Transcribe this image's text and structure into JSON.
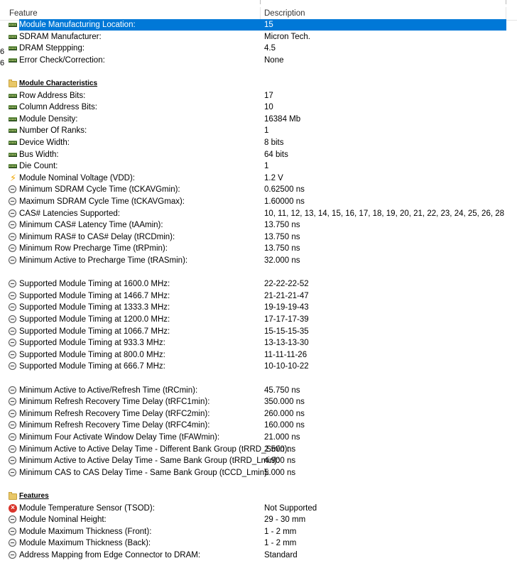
{
  "columns": {
    "feature": "Feature",
    "description": "Description"
  },
  "left_fragments": [
    "6",
    "6"
  ],
  "rows": [
    {
      "type": "item",
      "icon": "memory-module-icon",
      "feature": "Module Manufacturing Location:",
      "value": "15",
      "selected": true
    },
    {
      "type": "item",
      "icon": "memory-module-icon",
      "feature": "SDRAM Manufacturer:",
      "value": "Micron Tech."
    },
    {
      "type": "item",
      "icon": "memory-module-icon",
      "feature": "DRAM Steppping:",
      "value": "4.5"
    },
    {
      "type": "item",
      "icon": "memory-module-icon",
      "feature": "Error Check/Correction:",
      "value": "None"
    },
    {
      "type": "blank"
    },
    {
      "type": "section",
      "icon": "folder-icon",
      "feature": "Module Characteristics"
    },
    {
      "type": "item",
      "icon": "memory-module-icon",
      "feature": "Row Address Bits:",
      "value": "17"
    },
    {
      "type": "item",
      "icon": "memory-module-icon",
      "feature": "Column Address Bits:",
      "value": "10"
    },
    {
      "type": "item",
      "icon": "memory-module-icon",
      "feature": "Module Density:",
      "value": "16384 Mb"
    },
    {
      "type": "item",
      "icon": "memory-module-icon",
      "feature": "Number Of Ranks:",
      "value": "1"
    },
    {
      "type": "item",
      "icon": "memory-module-icon",
      "feature": "Device Width:",
      "value": "8 bits"
    },
    {
      "type": "item",
      "icon": "memory-module-icon",
      "feature": "Bus Width:",
      "value": "64 bits"
    },
    {
      "type": "item",
      "icon": "memory-module-icon",
      "feature": "Die Count:",
      "value": "1"
    },
    {
      "type": "item",
      "icon": "voltage-icon",
      "feature": "Module Nominal Voltage (VDD):",
      "value": "1.2 V"
    },
    {
      "type": "item",
      "icon": "clock-icon",
      "feature": "Minimum SDRAM Cycle Time (tCKAVGmin):",
      "value": "0.62500 ns"
    },
    {
      "type": "item",
      "icon": "clock-icon",
      "feature": "Maximum SDRAM Cycle Time (tCKAVGmax):",
      "value": "1.60000 ns"
    },
    {
      "type": "item",
      "icon": "clock-icon",
      "feature": "CAS# Latencies Supported:",
      "value": "10, 11, 12, 13, 14, 15, 16, 17, 18, 19, 20, 21, 22, 23, 24, 25, 26, 28"
    },
    {
      "type": "item",
      "icon": "clock-icon",
      "feature": "Minimum CAS# Latency Time (tAAmin):",
      "value": "13.750 ns"
    },
    {
      "type": "item",
      "icon": "clock-icon",
      "feature": "Minimum RAS# to CAS# Delay (tRCDmin):",
      "value": "13.750 ns"
    },
    {
      "type": "item",
      "icon": "clock-icon",
      "feature": "Minimum Row Precharge Time (tRPmin):",
      "value": "13.750 ns"
    },
    {
      "type": "item",
      "icon": "clock-icon",
      "feature": "Minimum Active to Precharge Time (tRASmin):",
      "value": "32.000 ns"
    },
    {
      "type": "blank"
    },
    {
      "type": "item",
      "icon": "clock-icon",
      "feature": "Supported Module Timing at 1600.0 MHz:",
      "value": "22-22-22-52"
    },
    {
      "type": "item",
      "icon": "clock-icon",
      "feature": "Supported Module Timing at 1466.7 MHz:",
      "value": "21-21-21-47"
    },
    {
      "type": "item",
      "icon": "clock-icon",
      "feature": "Supported Module Timing at 1333.3 MHz:",
      "value": "19-19-19-43"
    },
    {
      "type": "item",
      "icon": "clock-icon",
      "feature": "Supported Module Timing at 1200.0 MHz:",
      "value": "17-17-17-39"
    },
    {
      "type": "item",
      "icon": "clock-icon",
      "feature": "Supported Module Timing at 1066.7 MHz:",
      "value": "15-15-15-35"
    },
    {
      "type": "item",
      "icon": "clock-icon",
      "feature": "Supported Module Timing at 933.3 MHz:",
      "value": "13-13-13-30"
    },
    {
      "type": "item",
      "icon": "clock-icon",
      "feature": "Supported Module Timing at 800.0 MHz:",
      "value": "11-11-11-26"
    },
    {
      "type": "item",
      "icon": "clock-icon",
      "feature": "Supported Module Timing at 666.7 MHz:",
      "value": "10-10-10-22"
    },
    {
      "type": "blank"
    },
    {
      "type": "item",
      "icon": "clock-icon",
      "feature": "Minimum Active to Active/Refresh Time (tRCmin):",
      "value": "45.750 ns"
    },
    {
      "type": "item",
      "icon": "clock-icon",
      "feature": "Minimum Refresh Recovery Time Delay (tRFC1min):",
      "value": "350.000 ns"
    },
    {
      "type": "item",
      "icon": "clock-icon",
      "feature": "Minimum Refresh Recovery Time Delay (tRFC2min):",
      "value": "260.000 ns"
    },
    {
      "type": "item",
      "icon": "clock-icon",
      "feature": "Minimum Refresh Recovery Time Delay (tRFC4min):",
      "value": "160.000 ns"
    },
    {
      "type": "item",
      "icon": "clock-icon",
      "feature": "Minimum Four Activate Window Delay Time (tFAWmin):",
      "value": "21.000 ns"
    },
    {
      "type": "item",
      "icon": "clock-icon",
      "feature": "Minimum Active to Active Delay Time - Different Bank Group (tRRD_Smin):",
      "value": "2.500 ns"
    },
    {
      "type": "item",
      "icon": "clock-icon",
      "feature": "Minimum Active to Active Delay Time - Same Bank Group (tRRD_Lmin):",
      "value": "4.900 ns"
    },
    {
      "type": "item",
      "icon": "clock-icon",
      "feature": "Minimum CAS to CAS Delay Time - Same Bank Group (tCCD_Lmin):",
      "value": "5.000 ns"
    },
    {
      "type": "blank"
    },
    {
      "type": "section",
      "icon": "folder-icon",
      "feature": "Features"
    },
    {
      "type": "item",
      "icon": "error-icon",
      "feature": "Module Temperature Sensor (TSOD):",
      "value": "Not Supported"
    },
    {
      "type": "item",
      "icon": "clock-icon",
      "feature": "Module Nominal Height:",
      "value": "29 - 30 mm"
    },
    {
      "type": "item",
      "icon": "clock-icon",
      "feature": "Module Maximum Thickness (Front):",
      "value": "1 - 2 mm"
    },
    {
      "type": "item",
      "icon": "clock-icon",
      "feature": "Module Maximum Thickness (Back):",
      "value": "1 - 2 mm"
    },
    {
      "type": "item",
      "icon": "clock-icon",
      "feature": "Address Mapping from Edge Connector to DRAM:",
      "value": "Standard"
    }
  ]
}
